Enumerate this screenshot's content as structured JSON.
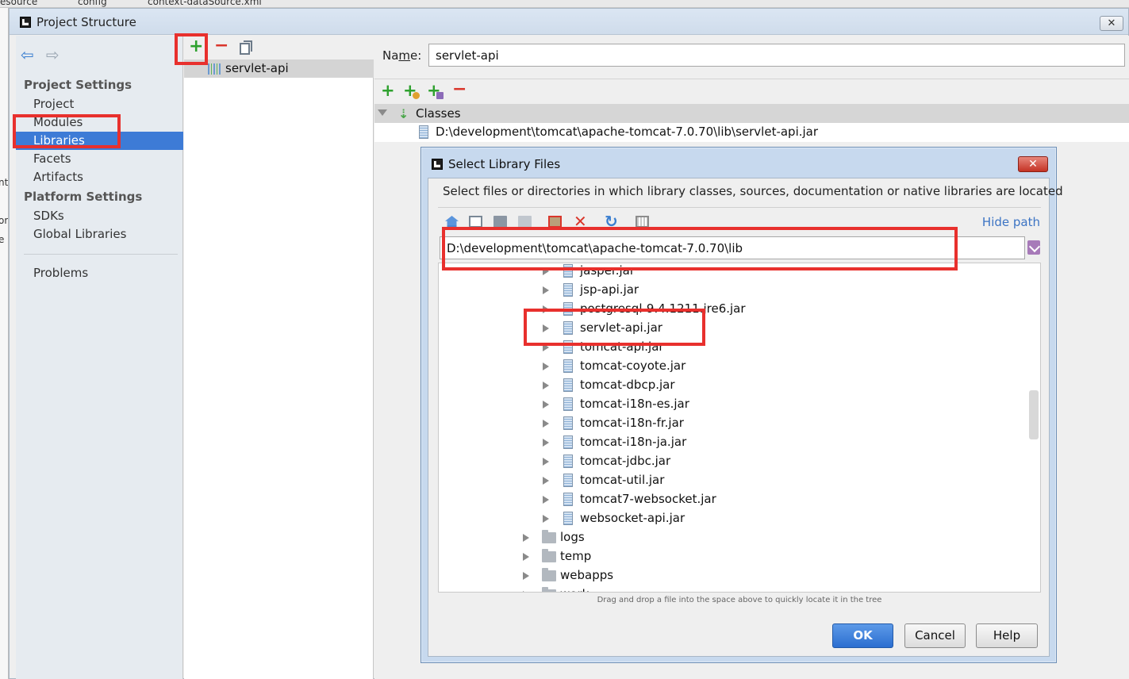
{
  "window": {
    "title": "Project Structure",
    "close_glyph": "✕"
  },
  "background": {
    "tab_text_1": "esource",
    "tab_text_2": "config",
    "tab_text_3": "context-dataSource.xml",
    "left_fragments": [
      "nt",
      "or",
      "e"
    ]
  },
  "sidebar": {
    "back_glyph": "⇦",
    "forward_glyph": "⇨",
    "project_settings_title": "Project Settings",
    "project_items": [
      "Project",
      "Modules",
      "Libraries",
      "Facets",
      "Artifacts"
    ],
    "selected_item": "Libraries",
    "platform_settings_title": "Platform Settings",
    "platform_items": [
      "SDKs",
      "Global Libraries"
    ],
    "problems": "Problems"
  },
  "libraries": {
    "add_glyph": "+",
    "remove_glyph": "−",
    "items": [
      "servlet-api"
    ]
  },
  "detail": {
    "name_label_prefix": "Na",
    "name_label_mnemonic": "m",
    "name_label_suffix": "e:",
    "name_value": "servlet-api",
    "add_glyph": "+",
    "remove_glyph": "−",
    "classes_label": "Classes",
    "class_path": "D:\\development\\tomcat\\apache-tomcat-7.0.70\\lib\\servlet-api.jar"
  },
  "dialog": {
    "title": "Select Library Files",
    "close_glyph": "✕",
    "description": "Select files or directories in which library classes, sources, documentation or native libraries are located",
    "hide_path": "Hide path",
    "path_value": "D:\\development\\tomcat\\apache-tomcat-7.0.70\\lib",
    "tree_jars": [
      "jasper.jar",
      "jsp-api.jar",
      "postgresql-9.4.1211.jre6.jar",
      "servlet-api.jar",
      "tomcat-api.jar",
      "tomcat-coyote.jar",
      "tomcat-dbcp.jar",
      "tomcat-i18n-es.jar",
      "tomcat-i18n-fr.jar",
      "tomcat-i18n-ja.jar",
      "tomcat-jdbc.jar",
      "tomcat-util.jar",
      "tomcat7-websocket.jar",
      "websocket-api.jar"
    ],
    "tree_folders": [
      "logs",
      "temp",
      "webapps",
      "work"
    ],
    "hint": "Drag and drop a file into the space above to quickly locate it in the tree",
    "ok_label": "OK",
    "cancel_label": "Cancel",
    "help_label": "Help"
  },
  "colors": {
    "selection_blue": "#3d7bd6",
    "annotation_red": "#e8302d",
    "add_green": "#2fa12f",
    "remove_red": "#d9362b",
    "link_blue": "#3c74c4"
  }
}
